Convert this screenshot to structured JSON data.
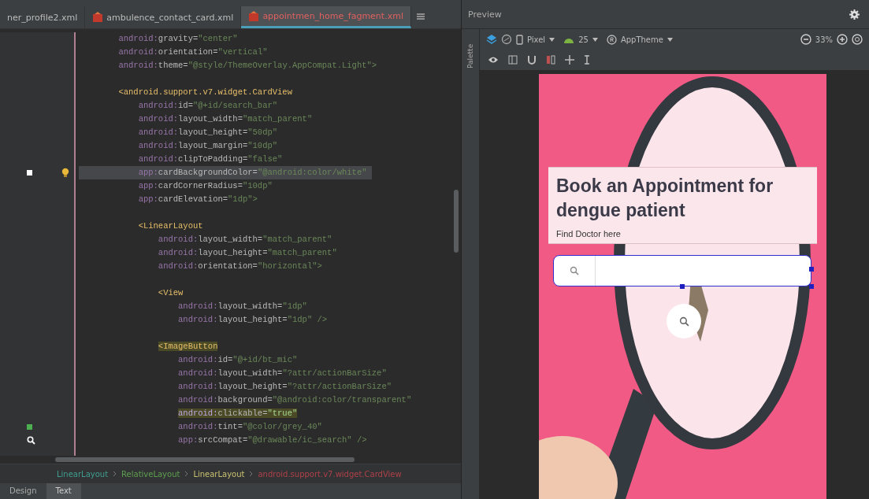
{
  "editor_tabs": [
    {
      "label": "ner_profile2.xml",
      "selected": false
    },
    {
      "label": "ambulence_contact_card.xml",
      "selected": false
    },
    {
      "label": "appointmen_home_fagment.xml",
      "selected": true
    }
  ],
  "code_lines": [
    {
      "kind": "attr",
      "ns": "android:",
      "name": "gravity=",
      "value": "\"center\"",
      "current": false,
      "highlighted": false
    },
    {
      "kind": "attr",
      "ns": "android:",
      "name": "orientation=",
      "value": "\"vertical\"",
      "current": false,
      "highlighted": false
    },
    {
      "kind": "attr",
      "ns": "android:",
      "name": "theme=",
      "value": "\"@style/ThemeOverlay.AppCompat.Light\">",
      "current": false,
      "highlighted": false
    },
    {
      "kind": "blank"
    },
    {
      "kind": "tag",
      "text": "<android.support.v7.widget.CardView",
      "current": false,
      "highlighted": false,
      "children": [
        {
          "kind": "attr",
          "ns": "android:",
          "name": "id=",
          "value": "\"@+id/search_bar\"",
          "current": false,
          "highlighted": false
        },
        {
          "kind": "attr",
          "ns": "android:",
          "name": "layout_width=",
          "value": "\"match_parent\"",
          "current": false,
          "highlighted": false
        },
        {
          "kind": "attr",
          "ns": "android:",
          "name": "layout_height=",
          "value": "\"50dp\"",
          "current": false,
          "highlighted": false
        },
        {
          "kind": "attr",
          "ns": "android:",
          "name": "layout_margin=",
          "value": "\"10dp\"",
          "current": false,
          "highlighted": false
        },
        {
          "kind": "attr",
          "ns": "android:",
          "name": "clipToPadding=",
          "value": "\"false\"",
          "current": false,
          "highlighted": false
        },
        {
          "kind": "attr",
          "ns": "app:",
          "name": "cardBackgroundColor=",
          "value": "\"@android:color/white\"",
          "current": true,
          "highlighted": false,
          "gutter": {
            "kind": "square"
          }
        },
        {
          "kind": "attr",
          "ns": "app:",
          "name": "cardCornerRadius=",
          "value": "\"10dp\"",
          "current": false,
          "highlighted": false
        },
        {
          "kind": "attr",
          "ns": "app:",
          "name": "cardElevation=",
          "value": "\"1dp\">",
          "current": false,
          "highlighted": false
        },
        {
          "kind": "blank"
        },
        {
          "kind": "tag",
          "text": "<LinearLayout",
          "current": false,
          "highlighted": false,
          "children": [
            {
              "kind": "attr",
              "ns": "android:",
              "name": "layout_width=",
              "value": "\"match_parent\"",
              "current": false,
              "highlighted": false
            },
            {
              "kind": "attr",
              "ns": "android:",
              "name": "layout_height=",
              "value": "\"match_parent\"",
              "current": false,
              "highlighted": false
            },
            {
              "kind": "attr",
              "ns": "android:",
              "name": "orientation=",
              "value": "\"horizontal\">",
              "current": false,
              "highlighted": false
            },
            {
              "kind": "blank"
            },
            {
              "kind": "tag",
              "text": "<View",
              "current": false,
              "highlighted": false,
              "children": [
                {
                  "kind": "attr",
                  "ns": "android:",
                  "name": "layout_width=",
                  "value": "\"1dp\"",
                  "current": false,
                  "highlighted": false
                },
                {
                  "kind": "attr",
                  "ns": "android:",
                  "name": "layout_height=",
                  "value": "\"1dp\" />",
                  "current": false,
                  "highlighted": false
                }
              ]
            },
            {
              "kind": "blank"
            },
            {
              "kind": "tag",
              "text": "<ImageButton",
              "current": false,
              "highlighted": true,
              "children": [
                {
                  "kind": "attr",
                  "ns": "android:",
                  "name": "id=",
                  "value": "\"@+id/bt_mic\"",
                  "current": false,
                  "highlighted": false
                },
                {
                  "kind": "attr",
                  "ns": "android:",
                  "name": "layout_width=",
                  "value": "\"?attr/actionBarSize\"",
                  "current": false,
                  "highlighted": false
                },
                {
                  "kind": "attr",
                  "ns": "android:",
                  "name": "layout_height=",
                  "value": "\"?attr/actionBarSize\"",
                  "current": false,
                  "highlighted": false
                },
                {
                  "kind": "attr",
                  "ns": "android:",
                  "name": "background=",
                  "value": "\"@android:color/transparent\"",
                  "current": false,
                  "highlighted": false
                },
                {
                  "kind": "attr",
                  "ns": "android:",
                  "name": "clickable=",
                  "value": "\"true\"",
                  "current": false,
                  "highlighted": true
                },
                {
                  "kind": "attr",
                  "ns": "android:",
                  "name": "tint=",
                  "value": "\"@color/grey_40\"",
                  "current": false,
                  "highlighted": false,
                  "gutter": {
                    "kind": "color"
                  }
                },
                {
                  "kind": "attr",
                  "ns": "app:",
                  "name": "srcCompat=",
                  "value": "\"@drawable/ic_search\" />",
                  "current": false,
                  "highlighted": false,
                  "gutter": {
                    "kind": "search"
                  }
                }
              ]
            }
          ]
        }
      ]
    }
  ],
  "breadcrumb": [
    {
      "label": "LinearLayout",
      "color": "#3f9e8f"
    },
    {
      "label": "RelativeLayout",
      "color": "#5f9e4f"
    },
    {
      "label": "LinearLayout",
      "color": "#c8c070"
    },
    {
      "label": "android.support.v7.widget.CardView",
      "color": "#b0404a"
    }
  ],
  "bottom_tabs": [
    {
      "label": "Design",
      "selected": false
    },
    {
      "label": "Text",
      "selected": true
    }
  ],
  "preview": {
    "title": "Preview",
    "palette_label": "Palette",
    "device": "Pixel",
    "api": "25",
    "theme": "AppTheme",
    "zoom": "33%",
    "screen": {
      "title": "Book an Appointment for dengue patient",
      "subtitle": "Find Doctor here"
    }
  }
}
